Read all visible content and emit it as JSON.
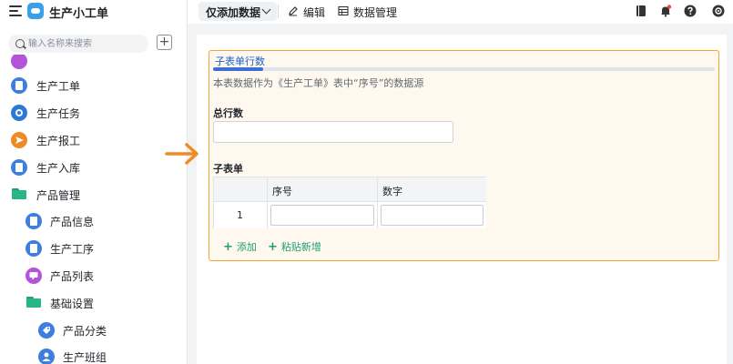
{
  "app": {
    "title": "生产小工单",
    "logo_color": "#3aa1e8"
  },
  "sidebar": {
    "search_placeholder": "输入名称来搜索",
    "add_label": "+",
    "items": [
      {
        "label": "生产工单",
        "icon": "document-icon",
        "color": "#3d7ee0"
      },
      {
        "label": "生产任务",
        "icon": "play-circle-icon",
        "color": "#2e79d6"
      },
      {
        "label": "生产报工",
        "icon": "send-icon",
        "color": "#f08a24"
      },
      {
        "label": "生产入库",
        "icon": "document-icon",
        "color": "#3d7ee0"
      },
      {
        "label": "产品管理",
        "icon": "folder-icon",
        "color": "#27b685"
      },
      {
        "label": "产品信息",
        "icon": "document-icon",
        "color": "#3d7ee0"
      },
      {
        "label": "生产工序",
        "icon": "document-icon",
        "color": "#3d7ee0"
      },
      {
        "label": "产品列表",
        "icon": "chat-icon",
        "color": "#b455d9"
      },
      {
        "label": "基础设置",
        "icon": "folder-icon",
        "color": "#27b685"
      },
      {
        "label": "产品分类",
        "icon": "tag-icon",
        "color": "#3d7ee0"
      },
      {
        "label": "生产班组",
        "icon": "user-icon",
        "color": "#3d7ee0"
      }
    ]
  },
  "toolbar": {
    "mode_label": "仅添加数据",
    "edit_label": "编辑",
    "data_manage_label": "数据管理"
  },
  "form": {
    "card_title": "子表单行数",
    "progress": 0.1,
    "description": "本表数据作为《生产工单》表中“序号”的数据源",
    "total_rows_label": "总行数",
    "total_rows_value": "",
    "subform_label": "子表单",
    "table": {
      "columns": [
        "序号",
        "数字"
      ],
      "rows": [
        {
          "index": "1",
          "seq": "",
          "num": ""
        }
      ]
    },
    "add_label": "添加",
    "paste_label": "粘贴新增"
  },
  "colors": {
    "accent": "#f3a62f",
    "link": "#1f9d74",
    "title_blue": "#1a61c8",
    "arrow": "#f08a24"
  }
}
